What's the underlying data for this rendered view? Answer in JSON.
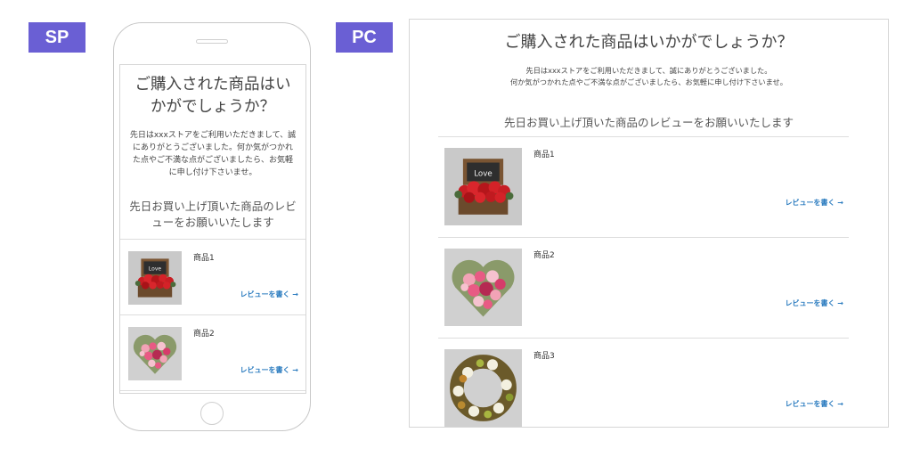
{
  "labels": {
    "sp": "SP",
    "pc": "PC"
  },
  "mobile": {
    "title": "ご購入された商品はいかがでしょうか？",
    "message": "先日はxxxストアをご利用いただきまして、誠にありがとうございました。何か気がつかれた点やご不満な点がございましたら、お気軽に申し付け下さいませ。",
    "subtitle": "先日お買い上げ頂いた商品のレビューをお願いいたします",
    "products": [
      {
        "name": "商品1",
        "link": "レビューを書く →",
        "image": "red-flower-box-icon"
      },
      {
        "name": "商品2",
        "link": "レビューを書く →",
        "image": "heart-flower-arrangement-icon"
      }
    ]
  },
  "desktop": {
    "title": "ご購入された商品はいかがでしょうか？",
    "message_line1": "先日はxxxストアをご利用いただきまして、誠にありがとうございました。",
    "message_line2": "何か気がつかれた点やご不満な点がございましたら、お気軽に申し付け下さいませ。",
    "subtitle": "先日お買い上げ頂いた商品のレビューをお願いいたします",
    "products": [
      {
        "name": "商品1",
        "link": "レビューを書く →",
        "image": "red-flower-box-icon"
      },
      {
        "name": "商品2",
        "link": "レビューを書く →",
        "image": "heart-flower-arrangement-icon"
      },
      {
        "name": "商品3",
        "link": "レビューを書く →",
        "image": "wreath-icon"
      }
    ]
  },
  "colors": {
    "label_bg": "#6a5fd4",
    "link": "#2a7bbf",
    "divider": "#dddddd"
  }
}
